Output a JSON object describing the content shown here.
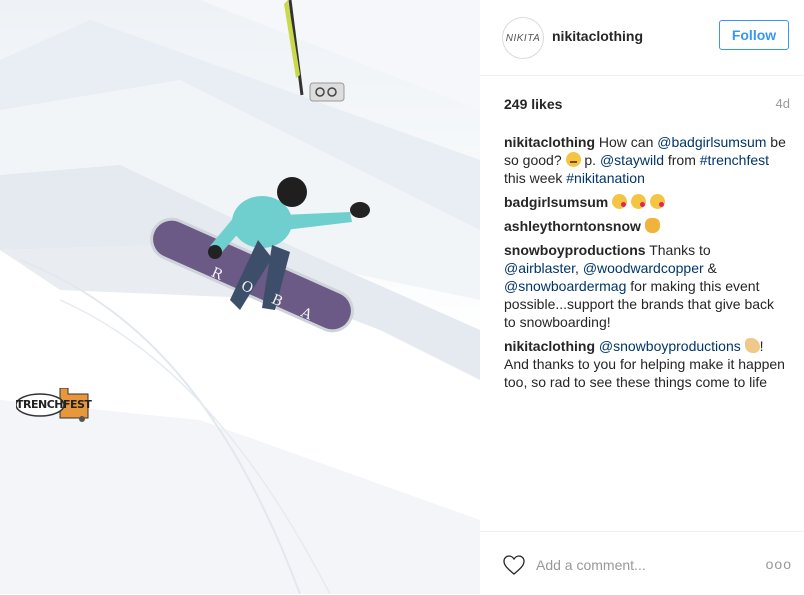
{
  "post": {
    "photo": {
      "board_text": "ROBA",
      "badge_text": "TRENCHFEST"
    },
    "header": {
      "avatar_text": "NIKITA",
      "username": "nikitaclothing",
      "follow_label": "Follow"
    },
    "likes": "249 likes",
    "time": "4d",
    "comments": [
      {
        "user": "nikitaclothing",
        "parts": [
          {
            "t": "text",
            "v": " How can "
          },
          {
            "t": "link",
            "v": "@badgirlsumsum"
          },
          {
            "t": "text",
            "v": " be so good? "
          },
          {
            "t": "emoji",
            "v": "thinking-face-emoji"
          },
          {
            "t": "text",
            "v": " p. "
          },
          {
            "t": "link",
            "v": "@staywild"
          },
          {
            "t": "text",
            "v": " from "
          },
          {
            "t": "link",
            "v": "#trenchfest"
          },
          {
            "t": "text",
            "v": " this week "
          },
          {
            "t": "link",
            "v": "#nikitanation"
          }
        ]
      },
      {
        "user": "badgirlsumsum",
        "parts": [
          {
            "t": "text",
            "v": " "
          },
          {
            "t": "emoji",
            "v": "kiss-face-emoji"
          },
          {
            "t": "text",
            "v": " "
          },
          {
            "t": "emoji",
            "v": "kiss-face-emoji"
          },
          {
            "t": "text",
            "v": " "
          },
          {
            "t": "emoji",
            "v": "kiss-face-emoji"
          }
        ]
      },
      {
        "user": "ashleythorntonsnow",
        "parts": [
          {
            "t": "text",
            "v": " "
          },
          {
            "t": "emoji",
            "v": "ok-hand-emoji"
          }
        ]
      },
      {
        "user": "snowboyproductions",
        "parts": [
          {
            "t": "text",
            "v": " Thanks to "
          },
          {
            "t": "link",
            "v": "@airblaster"
          },
          {
            "t": "text",
            "v": ", "
          },
          {
            "t": "link",
            "v": "@woodwardcopper"
          },
          {
            "t": "text",
            "v": " & "
          },
          {
            "t": "link",
            "v": "@snowboardermag"
          },
          {
            "t": "text",
            "v": " for making this event possible...support the brands that give back to snowboarding!"
          }
        ]
      },
      {
        "user": "nikitaclothing",
        "parts": [
          {
            "t": "text",
            "v": " "
          },
          {
            "t": "link",
            "v": "@snowboyproductions"
          },
          {
            "t": "text",
            "v": " "
          },
          {
            "t": "emoji",
            "v": "flexed-biceps-emoji"
          },
          {
            "t": "text",
            "v": "! And thanks to you for helping make it happen too, so rad to see these things come to life"
          }
        ]
      }
    ],
    "footer": {
      "comment_placeholder": "Add a comment...",
      "more_label": "ooo"
    },
    "colors": {
      "accent": "#3897f0",
      "link": "#003569",
      "text": "#262626",
      "muted": "#999999"
    }
  }
}
